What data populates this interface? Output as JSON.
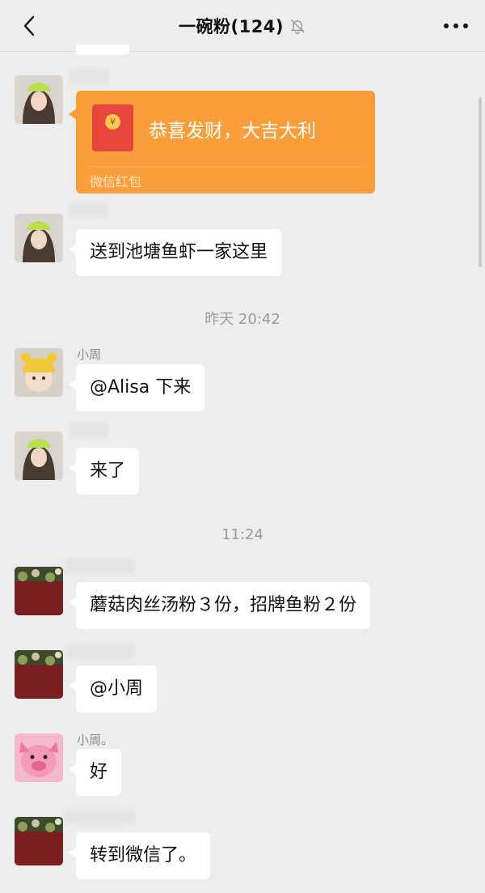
{
  "header": {
    "title": "一碗粉(124)",
    "back_icon": "chevron-left-icon",
    "mute_icon": "bell-off-icon",
    "more_icon": "more-dots-icon"
  },
  "timestamps": [
    "昨天 20:42",
    "11:24"
  ],
  "red_packet": {
    "text": "恭喜发财，大吉大利",
    "label": "微信红包",
    "color": "#fa9d3b"
  },
  "messages": [
    {
      "sender": "",
      "text": "送到池塘鱼虾一家这里"
    },
    {
      "sender": "小周",
      "text": "@Alisa 下来"
    },
    {
      "sender": "",
      "text": "来了"
    },
    {
      "sender": "",
      "text": "蘑菇肉丝汤粉３份，招牌鱼粉２份"
    },
    {
      "sender": "",
      "text": "@小周"
    },
    {
      "sender": "小周。",
      "text": "好"
    },
    {
      "sender": "",
      "text": "转到微信了。"
    }
  ],
  "colors": {
    "bubble": "#ffffff",
    "background": "#ededed",
    "red_packet": "#fa9d3b"
  }
}
